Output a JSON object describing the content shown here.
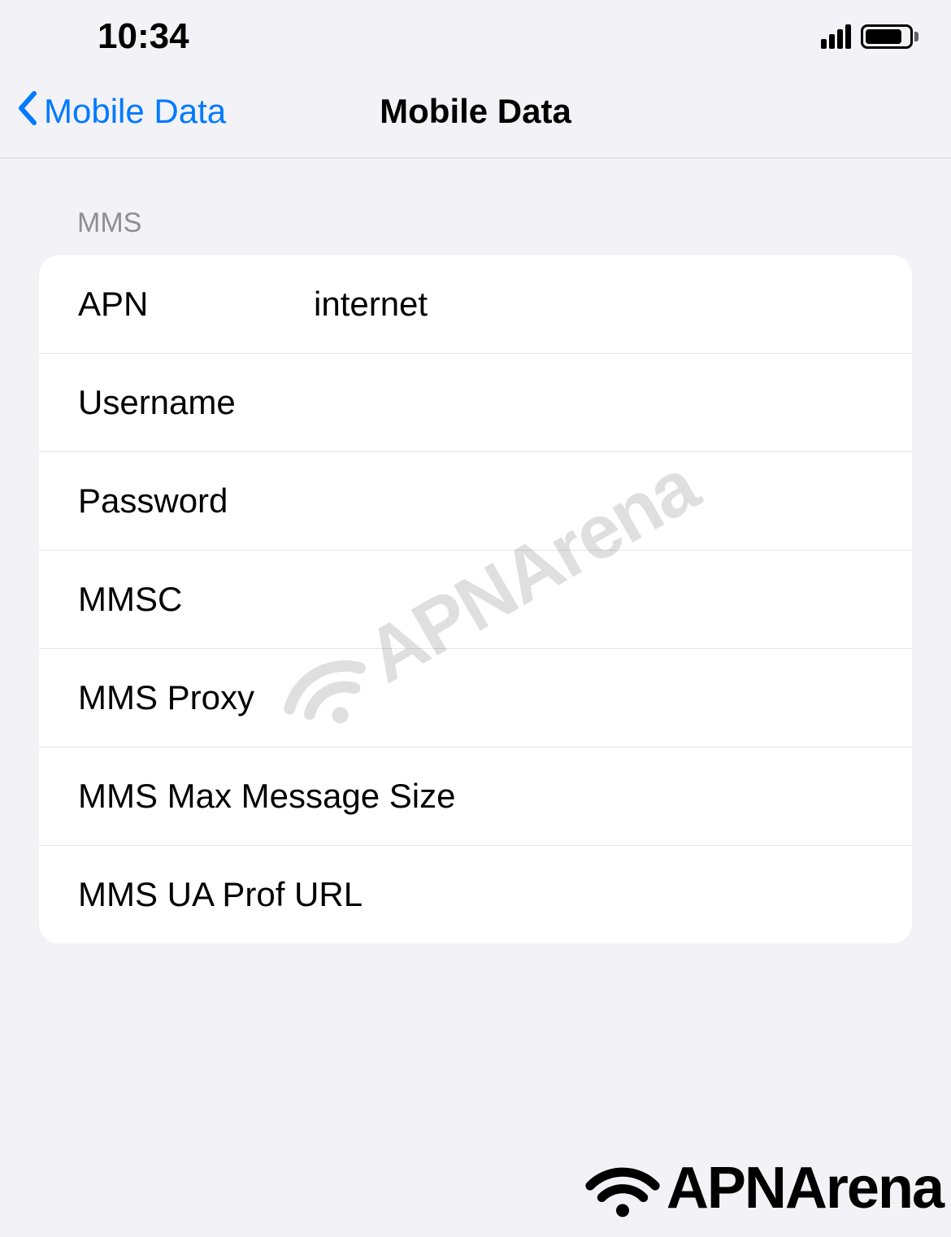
{
  "statusBar": {
    "time": "10:34"
  },
  "navBar": {
    "backLabel": "Mobile Data",
    "title": "Mobile Data"
  },
  "section": {
    "header": "MMS",
    "rows": {
      "apn": {
        "label": "APN",
        "value": "internet"
      },
      "username": {
        "label": "Username",
        "value": ""
      },
      "password": {
        "label": "Password",
        "value": ""
      },
      "mmsc": {
        "label": "MMSC",
        "value": ""
      },
      "mmsProxy": {
        "label": "MMS Proxy",
        "value": ""
      },
      "mmsMaxSize": {
        "label": "MMS Max Message Size",
        "value": ""
      },
      "mmsUaProf": {
        "label": "MMS UA Prof URL",
        "value": ""
      }
    }
  },
  "watermark": {
    "text": "APNArena"
  },
  "bottomLogo": {
    "text": "APNArena"
  }
}
